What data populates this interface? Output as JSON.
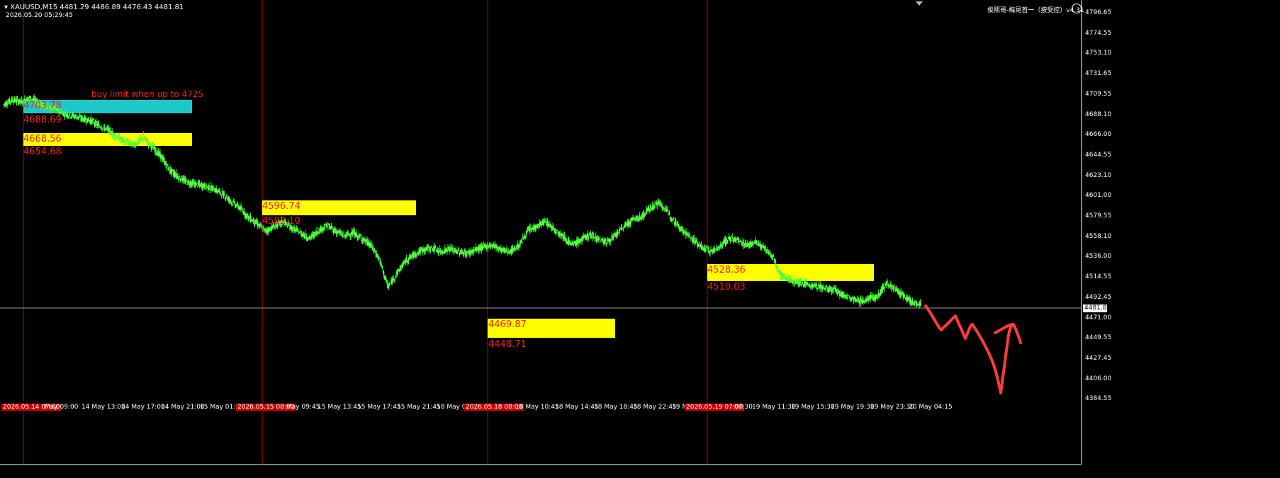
{
  "header": {
    "symbol_line": "XAUUSD,M15  4481.29 4486.89 4476.43 4481.81",
    "datetime": "2026.05.20 05:29:45",
    "indicator_name": "俊熙哥-梅晃首一（按受控）v4.31"
  },
  "price_axis": {
    "labels": [
      "4796.65",
      "4774.55",
      "4753.10",
      "4731.65",
      "4709.55",
      "4688.10",
      "4666.00",
      "4644.55",
      "4623.10",
      "4601.00",
      "4579.55",
      "4558.10",
      "4536.00",
      "4514.55",
      "4492.45",
      "4471.00",
      "4449.55",
      "4427.45",
      "4406.00",
      "4384.55"
    ],
    "current_price": "4481.81"
  },
  "time_axis": [
    {
      "text": "2026.05.14 07:00",
      "highlight": true
    },
    {
      "text": "May 09:00",
      "highlight": false
    },
    {
      "text": "14 May 13:00",
      "highlight": false
    },
    {
      "text": "14 May 17:00",
      "highlight": false
    },
    {
      "text": "14 May 21:00",
      "highlight": false
    },
    {
      "text": "15 May 01:45",
      "highlight": false
    },
    {
      "text": "2026.05.15 08:00",
      "highlight": true
    },
    {
      "text": "May 09:45",
      "highlight": false
    },
    {
      "text": "15 May 13:45",
      "highlight": false
    },
    {
      "text": "15 May 17:45",
      "highlight": false
    },
    {
      "text": "15 May 21:45",
      "highlight": false
    },
    {
      "text": "18 May 02",
      "highlight": false
    },
    {
      "text": "2026.05.18 08:00",
      "highlight": true
    },
    {
      "text": "18 May 10:45",
      "highlight": false
    },
    {
      "text": "18 May 14:45",
      "highlight": false
    },
    {
      "text": "18 May 18:45",
      "highlight": false
    },
    {
      "text": "18 May 22:45",
      "highlight": false
    },
    {
      "text": "19 M",
      "highlight": false
    },
    {
      "text": "2026.05.19 07:00",
      "highlight": true
    },
    {
      "text": "07:30",
      "highlight": false
    },
    {
      "text": "19 May 11:30",
      "highlight": false
    },
    {
      "text": "19 May 15:30",
      "highlight": false
    },
    {
      "text": "19 May 19:30",
      "highlight": false
    },
    {
      "text": "19 May 23:30",
      "highlight": false
    },
    {
      "text": "20 May 04:15",
      "highlight": false
    }
  ],
  "annotations": {
    "note": "buy limit when up to 4725",
    "zone1_top": "4703.78",
    "zone1_bottom": "4688.69",
    "zone2_top": "4668.56",
    "zone2_bottom": "4654.68",
    "zone3_top": "4596.74",
    "zone3_bottom": "4582.10",
    "zone4_top": "4528.36",
    "zone4_bottom": "4510.03",
    "zone5_top": "4469.87",
    "zone5_bottom": "4448.71"
  },
  "chart_data": {
    "type": "line",
    "title": "",
    "xlabel": "",
    "ylabel": "",
    "ylim": [
      4384.55,
      4796.65
    ],
    "series": [
      {
        "values": [
          4695,
          4700,
          4698,
          4702,
          4697,
          4692,
          4690,
          4685,
          4683,
          4680,
          4678,
          4672,
          4668,
          4660,
          4655,
          4652,
          4660,
          4650,
          4640,
          4625,
          4618,
          4612,
          4610,
          4608,
          4605,
          4600,
          4592,
          4585,
          4575,
          4568,
          4560,
          4565,
          4570,
          4563,
          4558,
          4552,
          4560,
          4566,
          4560,
          4555,
          4558,
          4552,
          4545,
          4530,
          4500,
          4515,
          4528,
          4535,
          4540,
          4542,
          4538,
          4541,
          4538,
          4536,
          4540,
          4543,
          4545,
          4540,
          4538,
          4545,
          4560,
          4565,
          4570,
          4562,
          4555,
          4545,
          4550,
          4556,
          4552,
          4548,
          4555,
          4565,
          4572,
          4575,
          4585,
          4590,
          4580,
          4568,
          4558,
          4550,
          4542,
          4538,
          4544,
          4552,
          4550,
          4545,
          4548,
          4542,
          4532,
          4512,
          4508,
          4505,
          4503,
          4501,
          4499,
          4497,
          4492,
          4488,
          4485,
          4488,
          4490,
          4505,
          4498,
          4490,
          4484,
          4482
        ]
      }
    ]
  }
}
